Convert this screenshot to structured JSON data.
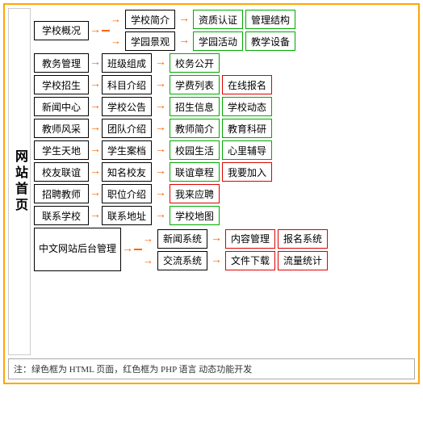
{
  "site": {
    "left_label": "网站首页",
    "note": "注：绿色框为 HTML 页面，红色框为 PHP 语言 动态功能开发"
  },
  "rows": [
    {
      "id": "school-overview",
      "level1": "学校概况",
      "has_sub_rows": true,
      "sub_rows": [
        {
          "level2": "学校简介",
          "items": [
            {
              "text": "资质认证",
              "color": "green"
            },
            {
              "text": "管理结构",
              "color": "green"
            }
          ]
        },
        {
          "level2": "学园景观",
          "items": [
            {
              "text": "学园活动",
              "color": "green"
            },
            {
              "text": "教学设备",
              "color": "green"
            }
          ]
        }
      ]
    },
    {
      "id": "academic",
      "level1": "教务管理",
      "sub_rows": [
        {
          "level2": "班级组成",
          "items": [
            {
              "text": "校务公开",
              "color": "green"
            }
          ]
        }
      ]
    },
    {
      "id": "enrollment",
      "level1": "学校招生",
      "sub_rows": [
        {
          "level2": "科目介绍",
          "items": [
            {
              "text": "学费列表",
              "color": "green"
            },
            {
              "text": "在线报名",
              "color": "red"
            }
          ]
        }
      ]
    },
    {
      "id": "news",
      "level1": "新闻中心",
      "sub_rows": [
        {
          "level2": "学校公告",
          "items": [
            {
              "text": "招生信息",
              "color": "green"
            },
            {
              "text": "学校动态",
              "color": "green"
            }
          ]
        }
      ]
    },
    {
      "id": "teacher",
      "level1": "教师风采",
      "sub_rows": [
        {
          "level2": "团队介绍",
          "items": [
            {
              "text": "教师简介",
              "color": "green"
            },
            {
              "text": "教育科研",
              "color": "green"
            }
          ]
        }
      ]
    },
    {
      "id": "student",
      "level1": "学生天地",
      "sub_rows": [
        {
          "level2": "学生案档",
          "items": [
            {
              "text": "校园生活",
              "color": "green"
            },
            {
              "text": "心里辅导",
              "color": "green"
            }
          ]
        }
      ]
    },
    {
      "id": "alumni",
      "level1": "校友联谊",
      "sub_rows": [
        {
          "level2": "知名校友",
          "items": [
            {
              "text": "联谊章程",
              "color": "green"
            },
            {
              "text": "我要加入",
              "color": "red"
            }
          ]
        }
      ]
    },
    {
      "id": "recruit",
      "level1": "招聘教师",
      "sub_rows": [
        {
          "level2": "职位介绍",
          "items": [
            {
              "text": "我来应聘",
              "color": "red"
            }
          ]
        }
      ]
    },
    {
      "id": "contact",
      "level1": "联系学校",
      "sub_rows": [
        {
          "level2": "联系地址",
          "items": [
            {
              "text": "学校地图",
              "color": "green"
            }
          ]
        }
      ]
    },
    {
      "id": "backend",
      "level1": "中文网站后台管理",
      "level1_multiline": true,
      "has_sub_rows": true,
      "sub_rows": [
        {
          "level2": "新闻系统",
          "items": [
            {
              "text": "内容管理",
              "color": "red"
            },
            {
              "text": "报名系统",
              "color": "red"
            }
          ]
        },
        {
          "level2": "交流系统",
          "items": [
            {
              "text": "文件下载",
              "color": "red"
            },
            {
              "text": "流量统计",
              "color": "red"
            }
          ]
        }
      ]
    }
  ]
}
